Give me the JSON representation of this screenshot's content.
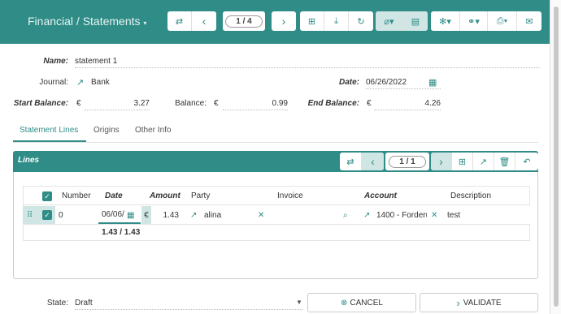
{
  "header": {
    "title": "Financial / Statements",
    "pager": "1 / 4"
  },
  "form": {
    "name_label": "Name:",
    "name_value": "statement 1",
    "journal_label": "Journal:",
    "journal_value": "Bank",
    "date_label": "Date:",
    "date_value": "06/26/2022",
    "start_balance_label": "Start Balance:",
    "start_currency": "€",
    "start_balance_value": "3.27",
    "balance_label": "Balance:",
    "balance_currency": "€",
    "balance_value": "0.99",
    "end_balance_label": "End Balance:",
    "end_currency": "€",
    "end_balance_value": "4.26"
  },
  "tabs": [
    {
      "label": "Statement Lines"
    },
    {
      "label": "Origins"
    },
    {
      "label": "Other Info"
    }
  ],
  "lines": {
    "title": "Lines",
    "pager": "1 / 1",
    "columns": [
      "Number",
      "Date",
      "Amount",
      "Party",
      "Invoice",
      "Account",
      "Description"
    ],
    "row": {
      "number": "0",
      "date": "06/06/",
      "currency": "€",
      "amount": "1.43",
      "party": "alina",
      "invoice": "",
      "account": "1400 - Forderu",
      "description": "test"
    },
    "sum": "1.43 / 1.43"
  },
  "footer": {
    "state_label": "State:",
    "state_value": "Draft",
    "cancel_label": "CANCEL",
    "validate_label": "VALIDATE"
  },
  "colors": {
    "accent": "#2f8c87",
    "accent_light": "#cfe6e4"
  }
}
